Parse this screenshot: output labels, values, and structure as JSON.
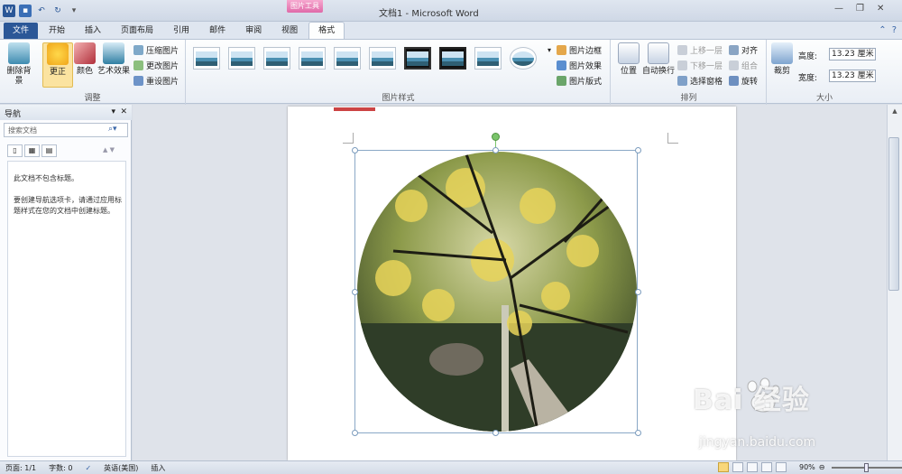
{
  "app": {
    "title": "文档1 - Microsoft Word",
    "context_tab": "图片工具"
  },
  "tabs": [
    "文件",
    "开始",
    "插入",
    "页面布局",
    "引用",
    "邮件",
    "审阅",
    "视图",
    "格式"
  ],
  "ribbon": {
    "adjust": {
      "label": "调整",
      "remove_bg": "删除背景",
      "correct": "更正",
      "color": "颜色",
      "artistic": "艺术效果",
      "compress": "压缩图片",
      "change": "更改图片",
      "reset": "重设图片"
    },
    "styles": {
      "label": "图片样式",
      "border": "图片边框",
      "effects": "图片效果",
      "layout": "图片版式"
    },
    "arrange": {
      "label": "排列",
      "position": "位置",
      "wrap": "自动换行",
      "forward": "上移一层",
      "backward": "下移一层",
      "selection": "选择窗格",
      "align": "对齐",
      "group": "组合",
      "rotate": "旋转"
    },
    "size": {
      "label": "大小",
      "crop": "裁剪",
      "height_label": "高度:",
      "height": "13.23 厘米",
      "width_label": "宽度:",
      "width": "13.23 厘米"
    }
  },
  "nav": {
    "title": "导航",
    "search_placeholder": "搜索文档",
    "msg1": "此文档不包含标题。",
    "msg2": "要创建导航选项卡，请通过应用标题样式在您的文档中创建标题。"
  },
  "status": {
    "page": "页面: 1/1",
    "words": "字数: 0",
    "language": "英语(美国)",
    "mode": "插入",
    "zoom": "90%"
  },
  "watermark": {
    "brand": "Bai 经验",
    "url": "jingyan.baidu.com"
  },
  "colors": {
    "file_tab": "#2b5797",
    "context_tab": "#e06aa8",
    "accent": "#f9d77a"
  }
}
